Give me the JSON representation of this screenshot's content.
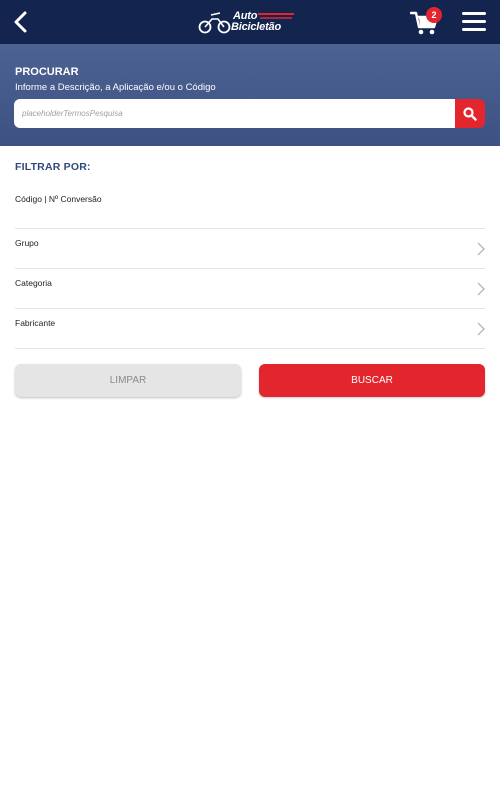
{
  "header": {
    "logo_line1": "Auto",
    "logo_line2": "Bicicletão",
    "cart_count": "2",
    "icons": [
      "back-arrow-icon",
      "cart-icon",
      "hamburger-menu-icon"
    ],
    "bg_color": "#13254f",
    "accent_color": "#e3262e"
  },
  "search": {
    "title": "PROCURAR",
    "subtitle": "Informe a Descrição, a Aplicação e/ou o Código",
    "placeholder": "placeholderTermosPesquisa",
    "button_icon": "search-icon"
  },
  "filters": {
    "title": "FILTRAR POR:",
    "items": [
      {
        "label": "Código | Nº Conversão"
      },
      {
        "label": "Grupo"
      },
      {
        "label": "Categoria"
      },
      {
        "label": "Fabricante"
      }
    ]
  },
  "actions": {
    "clear_label": "LIMPAR",
    "search_label": "BUSCAR"
  }
}
